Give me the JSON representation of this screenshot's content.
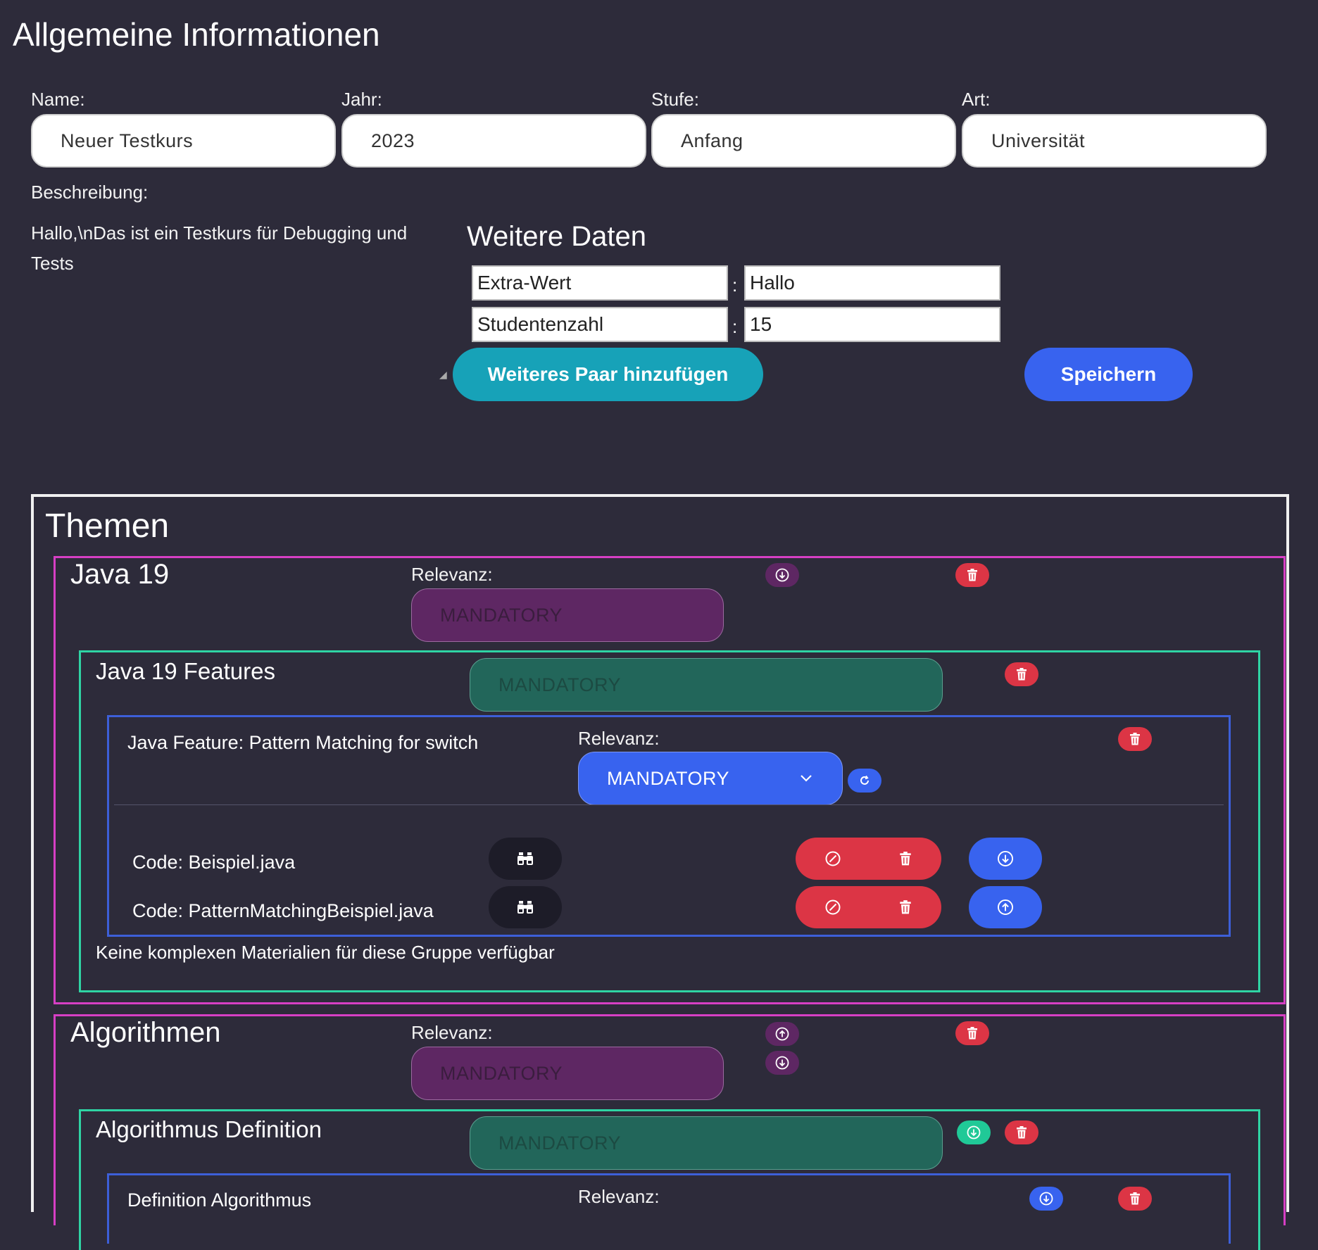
{
  "general": {
    "heading": "Allgemeine Informationen",
    "name_label": "Name:",
    "name_value": "Neuer Testkurs",
    "year_label": "Jahr:",
    "year_value": "2023",
    "level_label": "Stufe:",
    "level_value": "Anfang",
    "type_label": "Art:",
    "type_value": "Universität",
    "description_label": "Beschreibung:",
    "description_line1": "Hallo,\\nDas ist ein Testkurs für Debugging und",
    "description_line2": "Tests"
  },
  "extra": {
    "heading": "Weitere Daten",
    "separator": ":",
    "pairs": [
      {
        "key": "Extra-Wert",
        "value": "Hallo"
      },
      {
        "key": "Studentenzahl",
        "value": "15"
      }
    ],
    "add_pair_label": "Weiteres Paar hinzufügen",
    "save_label": "Speichern"
  },
  "themes": {
    "heading": "Themen",
    "relevance_label": "Relevanz:",
    "groups": [
      {
        "title": "Java 19",
        "relevance": "MANDATORY",
        "subgroups": [
          {
            "title": "Java 19 Features",
            "relevance": "MANDATORY",
            "features": [
              {
                "title": "Java Feature: Pattern Matching for switch",
                "relevance": "MANDATORY",
                "materials": [
                  {
                    "label": "Code: Beispiel.java"
                  },
                  {
                    "label": "Code: PatternMatchingBeispiel.java"
                  }
                ]
              }
            ],
            "empty_note": "Keine komplexen Materialien für diese Gruppe verfügbar"
          }
        ]
      },
      {
        "title": "Algorithmen",
        "relevance": "MANDATORY",
        "subgroups": [
          {
            "title": "Algorithmus Definition",
            "relevance": "MANDATORY",
            "features": [
              {
                "title": "Definition Algorithmus"
              }
            ]
          }
        ]
      }
    ]
  },
  "colors": {
    "background": "#2d2b3a",
    "teal_button": "#17a2b8",
    "blue_button": "#3863ef",
    "red_button": "#dc3545",
    "purple": "#5e2763",
    "green": "#22665a",
    "frame_pink": "#d63fc4",
    "frame_teal": "#2fd4a4",
    "frame_blue": "#3d5fd8"
  }
}
